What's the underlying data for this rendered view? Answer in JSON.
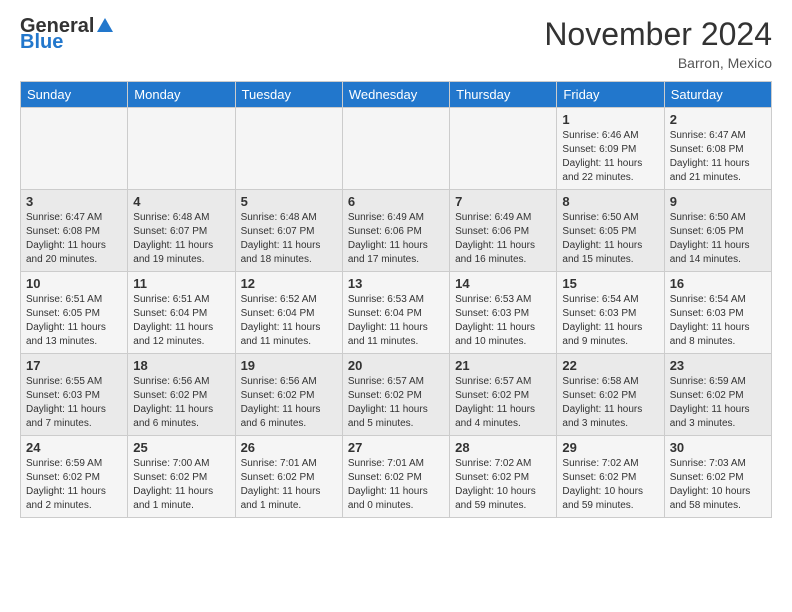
{
  "header": {
    "logo_general": "General",
    "logo_blue": "Blue",
    "month_title": "November 2024",
    "location": "Barron, Mexico"
  },
  "days_of_week": [
    "Sunday",
    "Monday",
    "Tuesday",
    "Wednesday",
    "Thursday",
    "Friday",
    "Saturday"
  ],
  "weeks": [
    [
      {
        "day": "",
        "info": ""
      },
      {
        "day": "",
        "info": ""
      },
      {
        "day": "",
        "info": ""
      },
      {
        "day": "",
        "info": ""
      },
      {
        "day": "",
        "info": ""
      },
      {
        "day": "1",
        "info": "Sunrise: 6:46 AM\nSunset: 6:09 PM\nDaylight: 11 hours and 22 minutes."
      },
      {
        "day": "2",
        "info": "Sunrise: 6:47 AM\nSunset: 6:08 PM\nDaylight: 11 hours and 21 minutes."
      }
    ],
    [
      {
        "day": "3",
        "info": "Sunrise: 6:47 AM\nSunset: 6:08 PM\nDaylight: 11 hours and 20 minutes."
      },
      {
        "day": "4",
        "info": "Sunrise: 6:48 AM\nSunset: 6:07 PM\nDaylight: 11 hours and 19 minutes."
      },
      {
        "day": "5",
        "info": "Sunrise: 6:48 AM\nSunset: 6:07 PM\nDaylight: 11 hours and 18 minutes."
      },
      {
        "day": "6",
        "info": "Sunrise: 6:49 AM\nSunset: 6:06 PM\nDaylight: 11 hours and 17 minutes."
      },
      {
        "day": "7",
        "info": "Sunrise: 6:49 AM\nSunset: 6:06 PM\nDaylight: 11 hours and 16 minutes."
      },
      {
        "day": "8",
        "info": "Sunrise: 6:50 AM\nSunset: 6:05 PM\nDaylight: 11 hours and 15 minutes."
      },
      {
        "day": "9",
        "info": "Sunrise: 6:50 AM\nSunset: 6:05 PM\nDaylight: 11 hours and 14 minutes."
      }
    ],
    [
      {
        "day": "10",
        "info": "Sunrise: 6:51 AM\nSunset: 6:05 PM\nDaylight: 11 hours and 13 minutes."
      },
      {
        "day": "11",
        "info": "Sunrise: 6:51 AM\nSunset: 6:04 PM\nDaylight: 11 hours and 12 minutes."
      },
      {
        "day": "12",
        "info": "Sunrise: 6:52 AM\nSunset: 6:04 PM\nDaylight: 11 hours and 11 minutes."
      },
      {
        "day": "13",
        "info": "Sunrise: 6:53 AM\nSunset: 6:04 PM\nDaylight: 11 hours and 11 minutes."
      },
      {
        "day": "14",
        "info": "Sunrise: 6:53 AM\nSunset: 6:03 PM\nDaylight: 11 hours and 10 minutes."
      },
      {
        "day": "15",
        "info": "Sunrise: 6:54 AM\nSunset: 6:03 PM\nDaylight: 11 hours and 9 minutes."
      },
      {
        "day": "16",
        "info": "Sunrise: 6:54 AM\nSunset: 6:03 PM\nDaylight: 11 hours and 8 minutes."
      }
    ],
    [
      {
        "day": "17",
        "info": "Sunrise: 6:55 AM\nSunset: 6:03 PM\nDaylight: 11 hours and 7 minutes."
      },
      {
        "day": "18",
        "info": "Sunrise: 6:56 AM\nSunset: 6:02 PM\nDaylight: 11 hours and 6 minutes."
      },
      {
        "day": "19",
        "info": "Sunrise: 6:56 AM\nSunset: 6:02 PM\nDaylight: 11 hours and 6 minutes."
      },
      {
        "day": "20",
        "info": "Sunrise: 6:57 AM\nSunset: 6:02 PM\nDaylight: 11 hours and 5 minutes."
      },
      {
        "day": "21",
        "info": "Sunrise: 6:57 AM\nSunset: 6:02 PM\nDaylight: 11 hours and 4 minutes."
      },
      {
        "day": "22",
        "info": "Sunrise: 6:58 AM\nSunset: 6:02 PM\nDaylight: 11 hours and 3 minutes."
      },
      {
        "day": "23",
        "info": "Sunrise: 6:59 AM\nSunset: 6:02 PM\nDaylight: 11 hours and 3 minutes."
      }
    ],
    [
      {
        "day": "24",
        "info": "Sunrise: 6:59 AM\nSunset: 6:02 PM\nDaylight: 11 hours and 2 minutes."
      },
      {
        "day": "25",
        "info": "Sunrise: 7:00 AM\nSunset: 6:02 PM\nDaylight: 11 hours and 1 minute."
      },
      {
        "day": "26",
        "info": "Sunrise: 7:01 AM\nSunset: 6:02 PM\nDaylight: 11 hours and 1 minute."
      },
      {
        "day": "27",
        "info": "Sunrise: 7:01 AM\nSunset: 6:02 PM\nDaylight: 11 hours and 0 minutes."
      },
      {
        "day": "28",
        "info": "Sunrise: 7:02 AM\nSunset: 6:02 PM\nDaylight: 10 hours and 59 minutes."
      },
      {
        "day": "29",
        "info": "Sunrise: 7:02 AM\nSunset: 6:02 PM\nDaylight: 10 hours and 59 minutes."
      },
      {
        "day": "30",
        "info": "Sunrise: 7:03 AM\nSunset: 6:02 PM\nDaylight: 10 hours and 58 minutes."
      }
    ]
  ]
}
